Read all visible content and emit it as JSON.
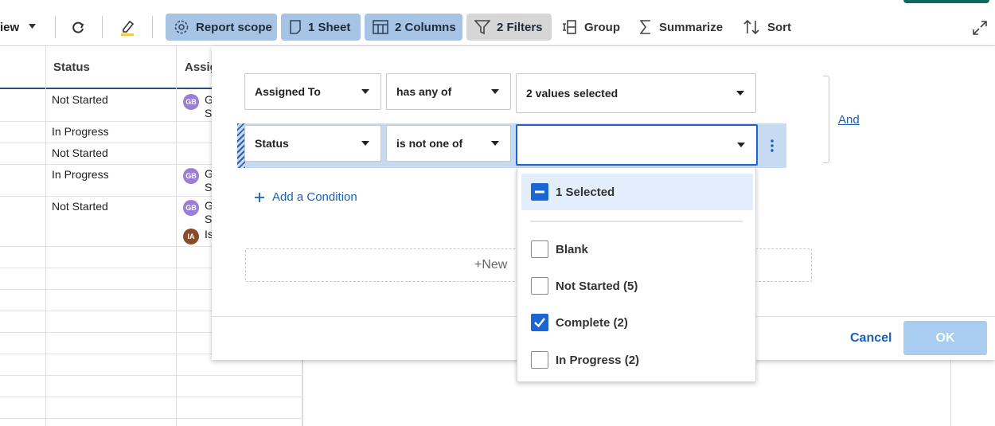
{
  "toolbar": {
    "view_label": "iew",
    "report_scope": "Report scope",
    "sheets": "1 Sheet",
    "columns": "2 Columns",
    "filters": "2 Filters",
    "group": "Group",
    "summarize": "Summarize",
    "sort": "Sort"
  },
  "grid": {
    "headers": {
      "status": "Status",
      "assigned": "Assig"
    },
    "rows": [
      {
        "status": "Not Started",
        "avatar": "GB",
        "assignee": "G",
        "assignee2": "S"
      },
      {
        "status": "In Progress"
      },
      {
        "status": "Not Started"
      },
      {
        "status": "In Progress",
        "avatar": "GB",
        "assignee": "G",
        "assignee2": "S"
      },
      {
        "status": "Not Started",
        "avatar": "GB",
        "assignee": "G",
        "assignee2": "S",
        "avatar2": "IA",
        "assignee3": "Is"
      }
    ]
  },
  "filter": {
    "condition1": {
      "field": "Assigned To",
      "operator": "has any of",
      "value": "2 values selected"
    },
    "condition2": {
      "field": "Status",
      "operator": "is not one of",
      "value": ""
    },
    "and_label": "And",
    "add_condition": "Add a Condition",
    "new_label": "New",
    "cancel": "Cancel",
    "ok": "OK"
  },
  "dropdown": {
    "summary": "1 Selected",
    "options": [
      {
        "label": "Blank",
        "checked": false
      },
      {
        "label": "Not Started (5)",
        "checked": false
      },
      {
        "label": "Complete (2)",
        "checked": true
      },
      {
        "label": "In Progress (2)",
        "checked": false
      }
    ]
  },
  "colors": {
    "accent": "#1a5fb4",
    "pill_blue": "#a7c4e4",
    "pill_grey": "#d6d6d6",
    "checkbox_checked": "#1a66d2",
    "avatar_gb": "#9b7fd4",
    "avatar_ia": "#8a4b2b",
    "ok_disabled": "#a9cdf0"
  }
}
